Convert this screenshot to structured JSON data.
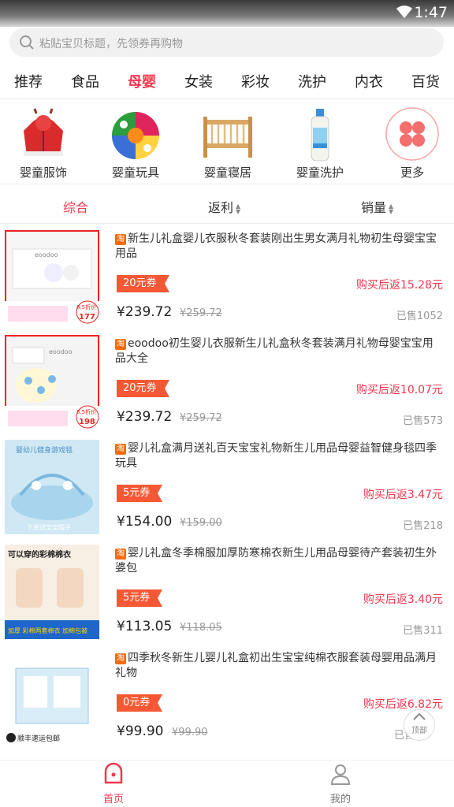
{
  "status": {
    "time": "1:47"
  },
  "search": {
    "placeholder": "粘贴宝贝标题，先领券再购物"
  },
  "tabs": [
    "推荐",
    "食品",
    "母婴",
    "女装",
    "彩妆",
    "洗护",
    "内衣",
    "百货"
  ],
  "active_tab": "母婴",
  "categories": [
    {
      "label": "婴童服饰",
      "icon": "red-baby-jacket-image"
    },
    {
      "label": "婴童玩具",
      "icon": "colorful-ball-image"
    },
    {
      "label": "婴童寝居",
      "icon": "wooden-crib-image"
    },
    {
      "label": "婴童洗护",
      "icon": "lotion-bottle-image"
    },
    {
      "label": "更多",
      "icon": "clover-icon"
    }
  ],
  "sort": {
    "comprehensive": "综合",
    "rebate": "返利",
    "sales": "销量"
  },
  "badge": "淘",
  "products": [
    {
      "title": "新生儿礼盒婴儿衣服秋冬套装刚出生男女满月礼物初生母婴宝宝用品",
      "coupon": "20元券",
      "rebate": "购买后返15.28元",
      "price": "¥239.72",
      "original_price": "¥259.72",
      "sold": "已售1052"
    },
    {
      "title": "eoodoo初生婴儿衣服新生儿礼盒秋冬套装满月礼物母婴宝宝用品大全",
      "coupon": "20元券",
      "rebate": "购买后返10.07元",
      "price": "¥239.72",
      "original_price": "¥259.72",
      "sold": "已售573"
    },
    {
      "title": "婴儿礼盒满月送礼百天宝宝礼物新生儿用品母婴益智健身毯四季玩具",
      "coupon": "5元券",
      "rebate": "购买后返3.47元",
      "price": "¥154.00",
      "original_price": "¥159.00",
      "sold": "已售218"
    },
    {
      "title": "婴儿礼盒冬季棉服加厚防寒棉衣新生儿用品母婴待产套装初生外婆包",
      "coupon": "5元券",
      "rebate": "购买后返3.40元",
      "price": "¥113.05",
      "original_price": "¥118.05",
      "sold": "已售311"
    },
    {
      "title": "四季秋冬新生儿婴儿礼盒初出生宝宝纯棉衣服套装母婴用品满月礼物",
      "coupon": "0元券",
      "rebate": "购买后返6.82元",
      "price": "¥99.90",
      "original_price": "¥99.90",
      "sold": "已售"
    }
  ],
  "thumb_texts": {
    "p1": {
      "brand": "eoodoo",
      "discount": "8.5折价",
      "amount": "177"
    },
    "p2": {
      "brand": "eoodoo",
      "discount": "8.5折价",
      "amount": "198"
    },
    "p3": {
      "headline": "婴幼儿健身游戏毯",
      "footer": "下单送宝宝帽子"
    },
    "p4": {
      "headline": "可以穿的彩棉棉衣",
      "footer": "加厚 彩棉两套棉衣 加棉包被"
    },
    "p5": {
      "footer": "顺丰速运包邮"
    }
  },
  "top_button": "顶部",
  "bottom_nav": {
    "home": "首页",
    "mine": "我的"
  },
  "colors": {
    "accent": "#f2384e",
    "coupon": "#f65835",
    "taobao_badge": "#f46b10"
  }
}
